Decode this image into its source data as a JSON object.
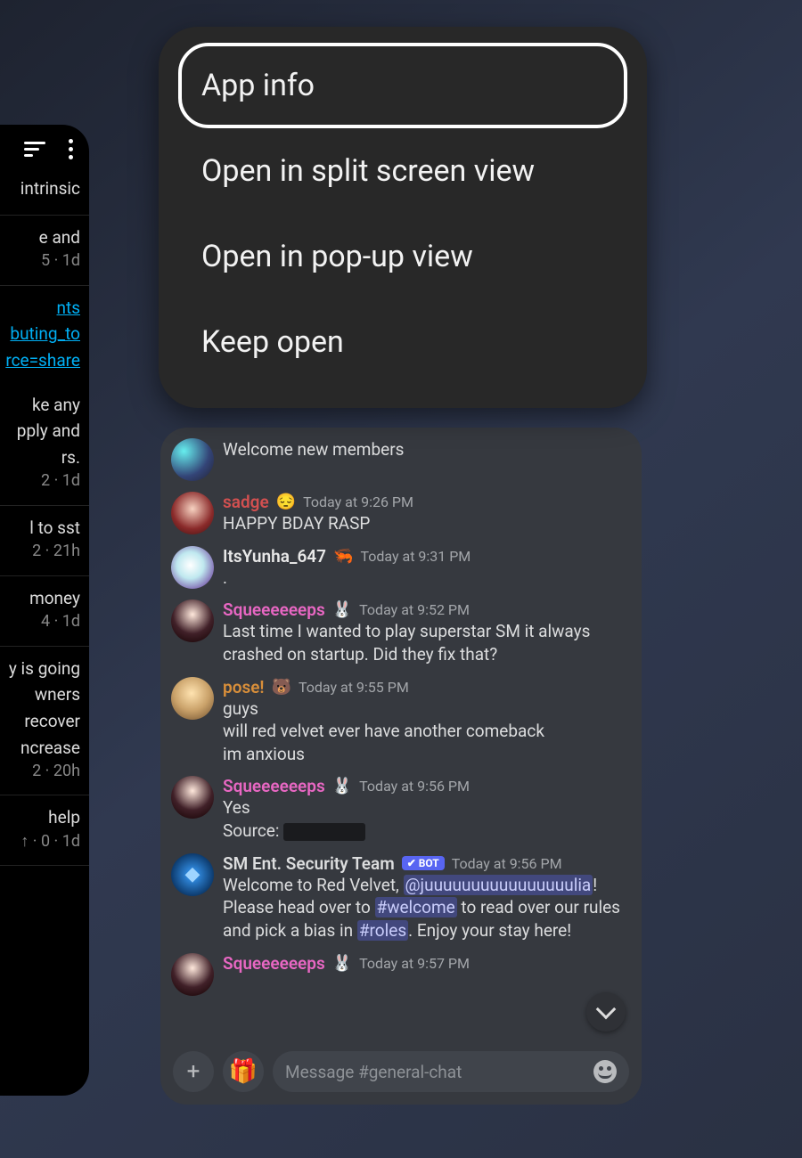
{
  "context_menu": {
    "items": [
      "App info",
      "Open in split screen view",
      "Open in pop-up view",
      "Keep open"
    ]
  },
  "left_card": {
    "blocks": [
      {
        "lines": [
          "intrinsic"
        ],
        "meta": ""
      },
      {
        "lines": [
          "e and"
        ],
        "meta": "5 · 1d"
      },
      {
        "links": [
          "nts",
          "buting_to",
          "rce=share"
        ],
        "lines": [
          "ke any",
          "pply and",
          "rs."
        ],
        "meta": "2 · 1d"
      },
      {
        "lines": [
          "l to sst"
        ],
        "meta": "2 · 21h"
      },
      {
        "lines": [
          " money"
        ],
        "meta": "4 · 1d"
      },
      {
        "lines": [
          "y is going",
          "wners",
          "recover",
          "ncrease"
        ],
        "meta": "2 · 20h"
      },
      {
        "lines": [
          " help"
        ],
        "meta": "↑ · 0 · 1d"
      }
    ]
  },
  "discord": {
    "messages": [
      {
        "avatar": "av-a",
        "username": "",
        "username_color": "",
        "timestamp": "",
        "emoji": "",
        "lines": [
          "Welcome new members"
        ]
      },
      {
        "avatar": "av-b",
        "username": "sadge",
        "username_color": "#d35050",
        "emoji": "😔",
        "timestamp": "Today at 9:26 PM",
        "lines": [
          "HAPPY BDAY RASP"
        ]
      },
      {
        "avatar": "av-c",
        "username": "ItsYunha_647",
        "username_color": "#e8e8e8",
        "emoji": "🦐",
        "timestamp": "Today at 9:31 PM",
        "lines": [
          "."
        ]
      },
      {
        "avatar": "av-d",
        "username": "Squeeeeeeps",
        "username_color": "#e867c3",
        "emoji": "🐰",
        "timestamp": "Today at 9:52 PM",
        "lines": [
          "Last time I wanted to play superstar SM it always crashed on startup. Did they fix that?"
        ]
      },
      {
        "avatar": "av-e",
        "username": "pose!",
        "username_color": "#d98f3a",
        "emoji": "🐻",
        "timestamp": "Today at 9:55 PM",
        "lines": [
          "guys",
          "will red velvet ever have another comeback",
          "im anxious"
        ]
      },
      {
        "avatar": "av-d",
        "username": "Squeeeeeeps",
        "username_color": "#e867c3",
        "emoji": "🐰",
        "timestamp": "Today at 9:56 PM",
        "lines": [
          "Yes"
        ],
        "source_prefix": "Source:"
      },
      {
        "avatar": "av-bot",
        "username": "SM Ent. Security Team",
        "username_color": "#dcddde",
        "bot": "✔ BOT",
        "timestamp": "Today at 9:56 PM",
        "rich": {
          "pre": "Welcome to Red Velvet, ",
          "mention1": "@juuuuuuuuuuuuuuuulia",
          "mid1": "! Please head over to ",
          "mention2": "#welcome",
          "mid2": " to read over our rules and pick a bias in ",
          "mention3": "#roles",
          "post": ". Enjoy your stay here!"
        }
      },
      {
        "avatar": "av-d",
        "username": "Squeeeeeeps",
        "username_color": "#e867c3",
        "emoji": "🐰",
        "timestamp": "Today at 9:57 PM",
        "lines": []
      }
    ],
    "input_placeholder": "Message #general-chat"
  }
}
